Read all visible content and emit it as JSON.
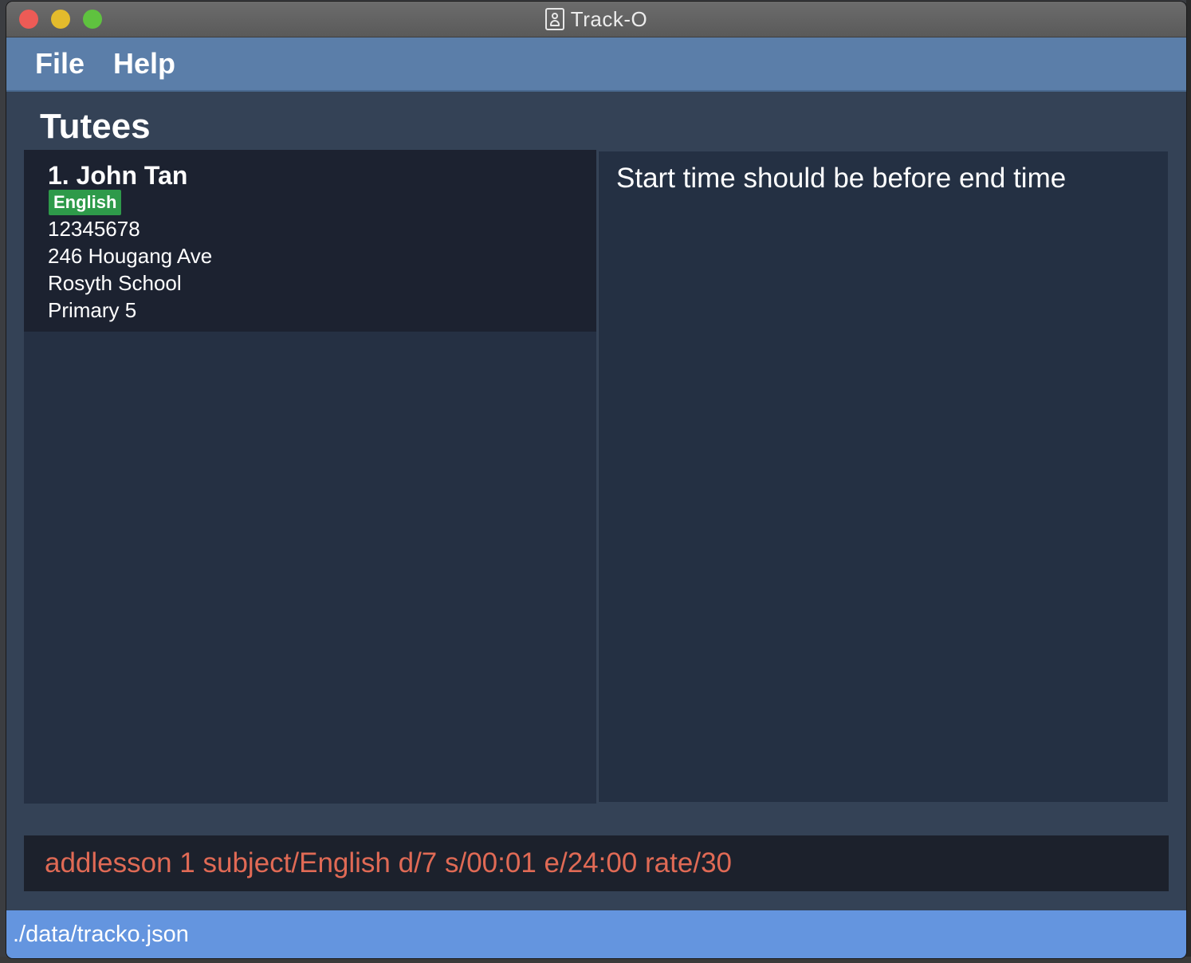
{
  "window": {
    "title": "Track-O",
    "title_icon": "contact-book-icon"
  },
  "menu": {
    "file_label": "File",
    "help_label": "Help"
  },
  "tutees": {
    "heading": "Tutees",
    "items": [
      {
        "index": "1.",
        "name": "John Tan",
        "index_name": "1.  John Tan",
        "tag": "English",
        "phone": "12345678",
        "address": "246 Hougang Ave",
        "school": "Rosyth School",
        "level": "Primary 5"
      }
    ]
  },
  "result": {
    "message": "Start time should be before end time"
  },
  "command": {
    "value": "addlesson 1 subject/English d/7 s/00:01 e/24:00 rate/30",
    "text_color": "#e06a55"
  },
  "status": {
    "file_path": "./data/tracko.json"
  },
  "colors": {
    "menubar": "#5b7ea9",
    "background": "#344256",
    "statusbar": "#6495df",
    "tag": "#2e9a4a"
  }
}
